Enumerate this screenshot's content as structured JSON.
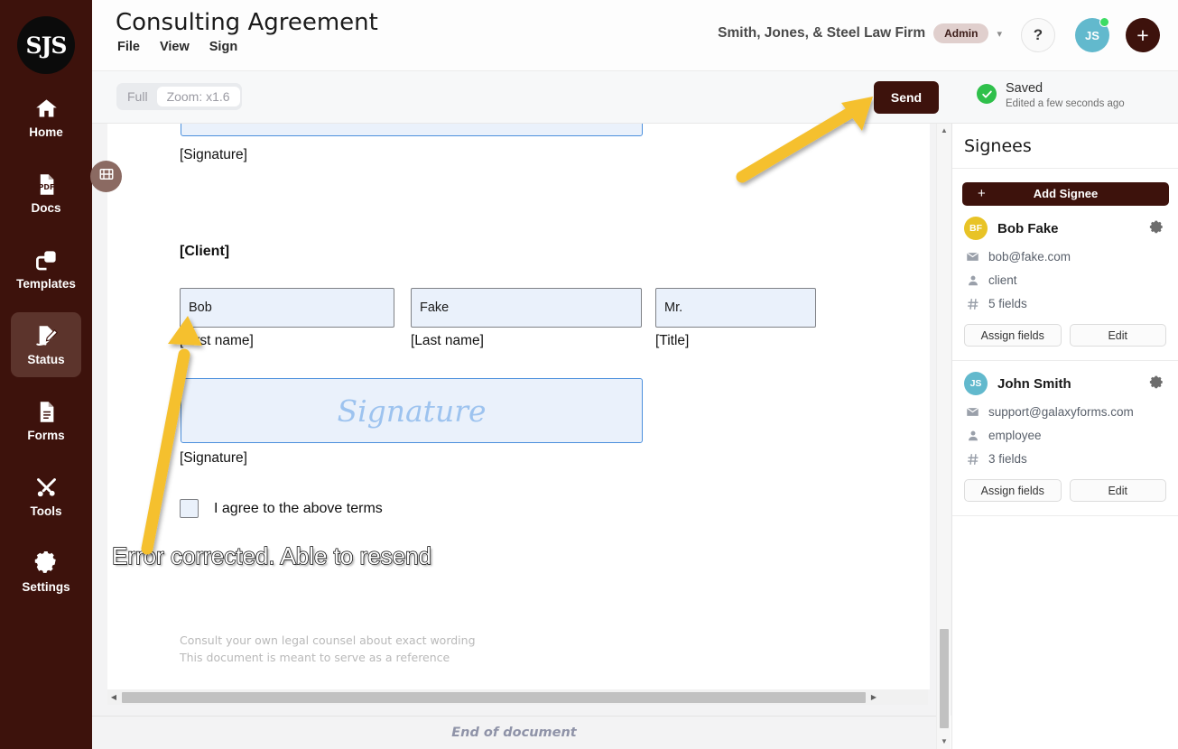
{
  "rail": {
    "logo_text": "SJS",
    "items": [
      {
        "label": "Home",
        "icon": "home-icon",
        "active": false
      },
      {
        "label": "Docs",
        "icon": "pdf-file-icon",
        "active": false
      },
      {
        "label": "Templates",
        "icon": "copy-icon",
        "active": false
      },
      {
        "label": "Status",
        "icon": "sign-document-icon",
        "active": true
      },
      {
        "label": "Forms",
        "icon": "form-document-icon",
        "active": false
      },
      {
        "label": "Tools",
        "icon": "tools-icon",
        "active": false
      },
      {
        "label": "Settings",
        "icon": "gear-icon",
        "active": false
      }
    ]
  },
  "header": {
    "document_title": "Consulting Agreement",
    "menu": [
      "File",
      "View",
      "Sign"
    ],
    "org_name": "Smith, Jones, & Steel Law Firm",
    "org_role": "Admin",
    "caret": "▾",
    "help_label": "?",
    "user_initials": "JS",
    "add_label": "+"
  },
  "toolbar": {
    "full_label": "Full",
    "zoom_label": "Zoom: x1.6",
    "send_label": "Send",
    "saved_title": "Saved",
    "saved_subtitle": "Edited a few seconds ago"
  },
  "document": {
    "employee_signature_label": "[Signature]",
    "client_heading": "[Client]",
    "fields": [
      {
        "value": "Bob",
        "label": "[First name]"
      },
      {
        "value": "Fake",
        "label": "[Last name]"
      },
      {
        "value": "Mr.",
        "label": "[Title]"
      }
    ],
    "signature_placeholder": "Signature",
    "client_signature_label": "[Signature]",
    "agree_label": "I agree to the above terms",
    "footnote_1": "Consult your own legal counsel about exact wording",
    "footnote_2": "This document is meant to serve as a reference",
    "end_of_document": "End of document"
  },
  "signees_panel": {
    "title": "Signees",
    "add_signee_label": "Add Signee",
    "add_signee_plus": "+",
    "signees": [
      {
        "initials": "BF",
        "avatar_color": "#e8c326",
        "name": "Bob Fake",
        "email": "bob@fake.com",
        "role": "client",
        "fields": "5 fields",
        "assign_label": "Assign fields",
        "edit_label": "Edit"
      },
      {
        "initials": "JS",
        "avatar_color": "#62b9cd",
        "name": "John Smith",
        "email": "support@galaxyforms.com",
        "role": "employee",
        "fields": "3 fields",
        "assign_label": "Assign fields",
        "edit_label": "Edit"
      }
    ]
  },
  "annotations": {
    "note_text": "Error corrected. Able to resend",
    "arrow_color": "#f5c02e"
  },
  "colors": {
    "brand_dark": "#3d120c",
    "accent_yellow": "#f5c02e",
    "field_fill": "#eaf1fb",
    "field_border": "#4b8fdd",
    "saved_green": "#2fc04b"
  }
}
